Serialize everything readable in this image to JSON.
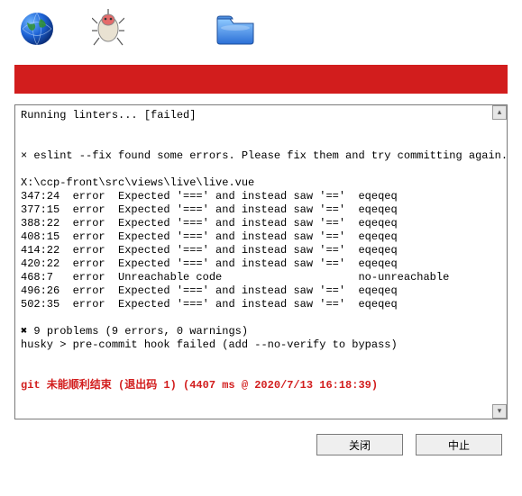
{
  "icons": {
    "globe": "globe-icon",
    "bug": "bug-icon",
    "folder": "folder-icon"
  },
  "console": {
    "line1": "Running linters... [failed]",
    "line2": "",
    "line3": "",
    "line4": "× eslint --fix found some errors. Please fix them and try committing again.",
    "line5": "",
    "line6": "X:\\ccp-front\\src\\views\\live\\live.vue",
    "r1": "347:24  error  Expected '===' and instead saw '=='  eqeqeq",
    "r2": "377:15  error  Expected '===' and instead saw '=='  eqeqeq",
    "r3": "388:22  error  Expected '===' and instead saw '=='  eqeqeq",
    "r4": "408:15  error  Expected '===' and instead saw '=='  eqeqeq",
    "r5": "414:22  error  Expected '===' and instead saw '=='  eqeqeq",
    "r6": "420:22  error  Expected '===' and instead saw '=='  eqeqeq",
    "r7": "468:7   error  Unreachable code                     no-unreachable",
    "r8": "496:26  error  Expected '===' and instead saw '=='  eqeqeq",
    "r9": "502:35  error  Expected '===' and instead saw '=='  eqeqeq",
    "blank1": "",
    "summary": "✖ 9 problems (9 errors, 0 warnings)",
    "husky": "husky > pre-commit hook failed (add --no-verify to bypass)",
    "blank2": "",
    "blank3": "",
    "final": "git 未能顺利结束 (退出码 1) (4407 ms @ 2020/7/13 16:18:39)"
  },
  "buttons": {
    "close": "关闭",
    "abort": "中止"
  }
}
